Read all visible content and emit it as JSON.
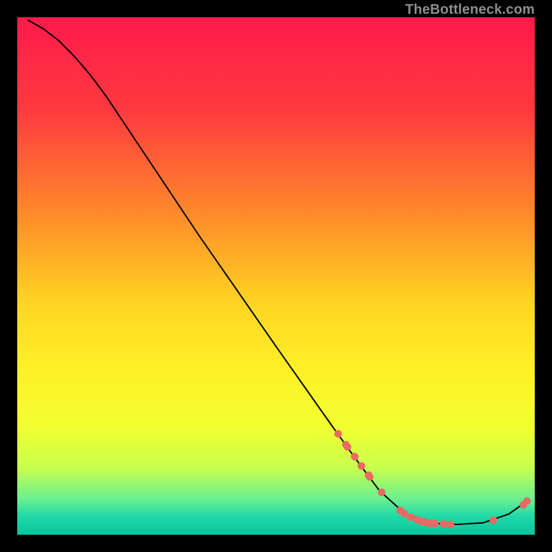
{
  "watermark": "TheBottleneck.com",
  "chart_data": {
    "type": "line",
    "title": "",
    "xlabel": "",
    "ylabel": "",
    "xlim": [
      0,
      100
    ],
    "ylim": [
      0,
      100
    ],
    "grid": false,
    "legend": false,
    "gradient_stops": [
      {
        "pos": 0.0,
        "color": "#ff1a4b"
      },
      {
        "pos": 0.18,
        "color": "#ff3a3f"
      },
      {
        "pos": 0.38,
        "color": "#ff8a2a"
      },
      {
        "pos": 0.55,
        "color": "#ffd423"
      },
      {
        "pos": 0.68,
        "color": "#fff026"
      },
      {
        "pos": 0.79,
        "color": "#f2ff30"
      },
      {
        "pos": 0.87,
        "color": "#c8ff4d"
      },
      {
        "pos": 0.93,
        "color": "#6cf08f"
      },
      {
        "pos": 0.965,
        "color": "#20d8a8"
      },
      {
        "pos": 1.0,
        "color": "#08c79a"
      }
    ],
    "series": [
      {
        "name": "bottleneck-curve",
        "stroke": "#000000",
        "points": [
          {
            "x": 2.0,
            "y": 99.5
          },
          {
            "x": 5.0,
            "y": 97.8
          },
          {
            "x": 8.0,
            "y": 95.5
          },
          {
            "x": 11.0,
            "y": 92.5
          },
          {
            "x": 14.0,
            "y": 89.0
          },
          {
            "x": 17.0,
            "y": 85.0
          },
          {
            "x": 20.0,
            "y": 80.5
          },
          {
            "x": 25.0,
            "y": 73.0
          },
          {
            "x": 30.0,
            "y": 65.5
          },
          {
            "x": 35.0,
            "y": 58.0
          },
          {
            "x": 40.0,
            "y": 50.8
          },
          {
            "x": 45.0,
            "y": 43.6
          },
          {
            "x": 50.0,
            "y": 36.4
          },
          {
            "x": 55.0,
            "y": 29.3
          },
          {
            "x": 60.0,
            "y": 22.2
          },
          {
            "x": 65.0,
            "y": 15.2
          },
          {
            "x": 70.0,
            "y": 8.5
          },
          {
            "x": 75.0,
            "y": 4.0
          },
          {
            "x": 80.0,
            "y": 2.2
          },
          {
            "x": 85.0,
            "y": 2.0
          },
          {
            "x": 90.0,
            "y": 2.3
          },
          {
            "x": 95.0,
            "y": 4.0
          },
          {
            "x": 98.5,
            "y": 6.5
          }
        ]
      },
      {
        "name": "data-markers",
        "marker": "circle",
        "color": "#e96a63",
        "points": [
          {
            "x": 62.0,
            "y": 19.5
          },
          {
            "x": 63.5,
            "y": 17.4
          },
          {
            "x": 63.8,
            "y": 17.0
          },
          {
            "x": 65.2,
            "y": 15.1
          },
          {
            "x": 66.5,
            "y": 13.3
          },
          {
            "x": 67.9,
            "y": 11.5
          },
          {
            "x": 68.1,
            "y": 11.2
          },
          {
            "x": 70.4,
            "y": 8.2
          },
          {
            "x": 74.0,
            "y": 4.7
          },
          {
            "x": 74.8,
            "y": 4.1
          },
          {
            "x": 76.0,
            "y": 3.4
          },
          {
            "x": 77.3,
            "y": 2.9
          },
          {
            "x": 78.0,
            "y": 2.6
          },
          {
            "x": 78.6,
            "y": 2.5
          },
          {
            "x": 79.3,
            "y": 2.3
          },
          {
            "x": 80.0,
            "y": 2.2
          },
          {
            "x": 80.7,
            "y": 2.2
          },
          {
            "x": 82.4,
            "y": 2.1
          },
          {
            "x": 83.7,
            "y": 2.0
          },
          {
            "x": 92.0,
            "y": 2.8
          },
          {
            "x": 97.8,
            "y": 5.8
          },
          {
            "x": 98.5,
            "y": 6.5
          }
        ]
      }
    ]
  }
}
